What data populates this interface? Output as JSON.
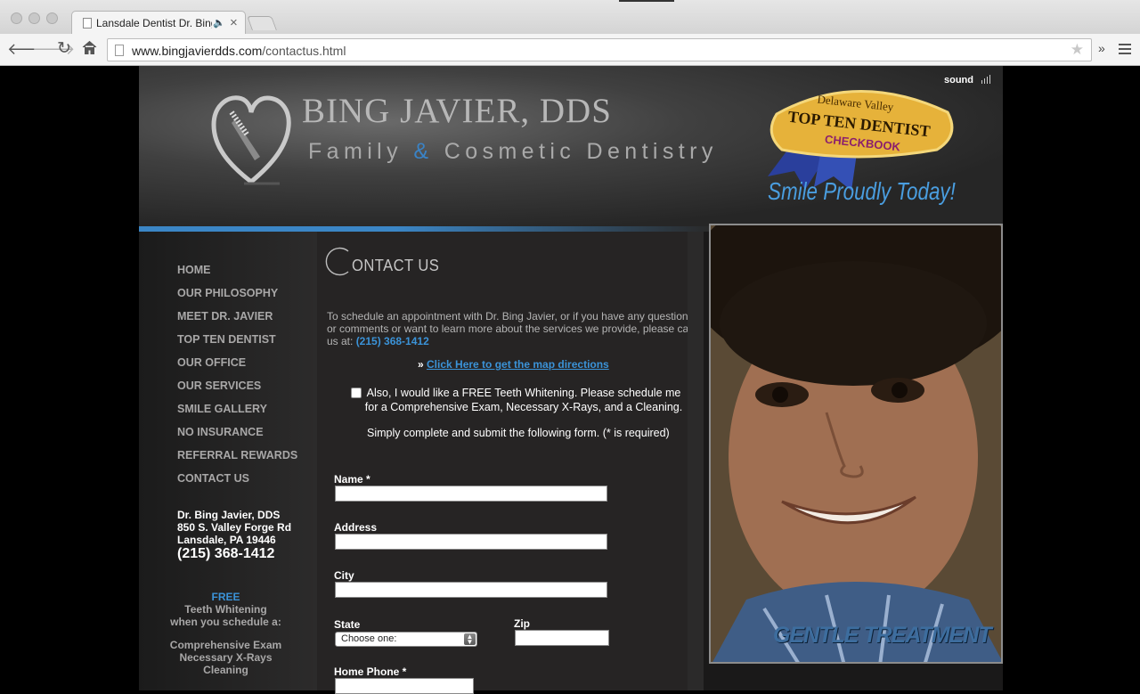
{
  "browser": {
    "tab_title": "Lansdale Dentist Dr. Bing Javier",
    "tab_close": "×",
    "url_domain": "www.bingjavierdds.com",
    "url_path": "/contactus.html",
    "ext_label": "»"
  },
  "header": {
    "brand_name": "BING JAVIER, DDS",
    "brand_sub_1": "Family ",
    "brand_amp": "&",
    "brand_sub_2": " Cosmetic Dentistry",
    "sound_label": "sound",
    "badge_top": "Delaware Valley",
    "badge_main": "TOP TEN DENTIST",
    "badge_checkbook": "CHECKBOOK",
    "tagline": "Smile Proudly Today!"
  },
  "nav": {
    "items": [
      "HOME",
      "OUR PHILOSOPHY",
      "MEET DR. JAVIER",
      "TOP TEN DENTIST",
      "OUR OFFICE",
      "OUR SERVICES",
      "SMILE GALLERY",
      "NO INSURANCE",
      "REFERRAL REWARDS",
      "CONTACT US"
    ]
  },
  "address": {
    "name": "Dr. Bing Javier, DDS",
    "street": "850 S. Valley Forge Rd",
    "city": "Lansdale, PA 19446",
    "phone": "(215) 368-1412"
  },
  "promo": {
    "free": "FREE",
    "line1": "Teeth Whitening",
    "line2": "when you schedule a:",
    "item1": "Comprehensive Exam",
    "item2": "Necessary X-Rays",
    "item3": "Cleaning"
  },
  "main": {
    "title_initial": "C",
    "title_rest": "ONTACT US",
    "intro": "To schedule an appointment with Dr. Bing Javier, or if you have any questions or comments or want to learn more about the services we provide, please call us at: ",
    "intro_phone": "(215) 368-1412",
    "map_prefix": "» ",
    "map_link": "Click Here to get the map directions",
    "offer": "Also, I would like a FREE Teeth Whitening. Please schedule me for a Comprehensive Exam, Necessary X-Rays, and a Cleaning.",
    "required_note": "Simply complete and submit the following form. (* is required)"
  },
  "form": {
    "name_label": "Name *",
    "address_label": "Address",
    "city_label": "City",
    "state_label": "State",
    "state_value": "Choose one:",
    "zip_label": "Zip",
    "home_phone_label": "Home Phone *"
  },
  "photo": {
    "caption": "GENTLE TREATMENT"
  },
  "colors": {
    "accent_blue": "#3b93d8",
    "nav_gray": "#a8a7a7"
  }
}
